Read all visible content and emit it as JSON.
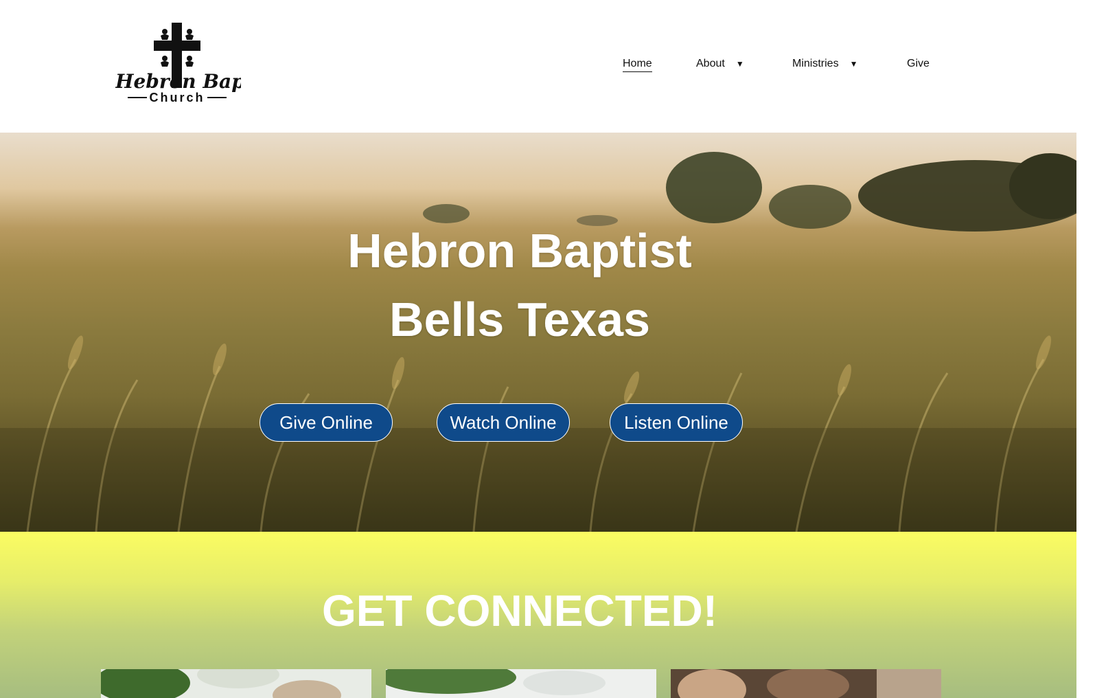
{
  "logo": {
    "line1": "Hebron Baptist",
    "line2": "Church"
  },
  "nav": {
    "items": [
      {
        "label": "Home",
        "active": true,
        "dropdown": false
      },
      {
        "label": "About",
        "active": false,
        "dropdown": true
      },
      {
        "label": "Ministries",
        "active": false,
        "dropdown": true
      },
      {
        "label": "Give",
        "active": false,
        "dropdown": false
      }
    ],
    "caret_icon": "caret-down-icon"
  },
  "hero": {
    "title_line1": "Hebron Baptist",
    "title_line2": "Bells Texas",
    "buttons": [
      {
        "label": "Give Online"
      },
      {
        "label": "Watch Online"
      },
      {
        "label": "Listen Online"
      }
    ],
    "button_color": "#0f4a8a"
  },
  "connect": {
    "title": "GET CONNECTED!",
    "gradient_top": "#fbfc62",
    "gradient_bottom": "#a6bd80"
  }
}
